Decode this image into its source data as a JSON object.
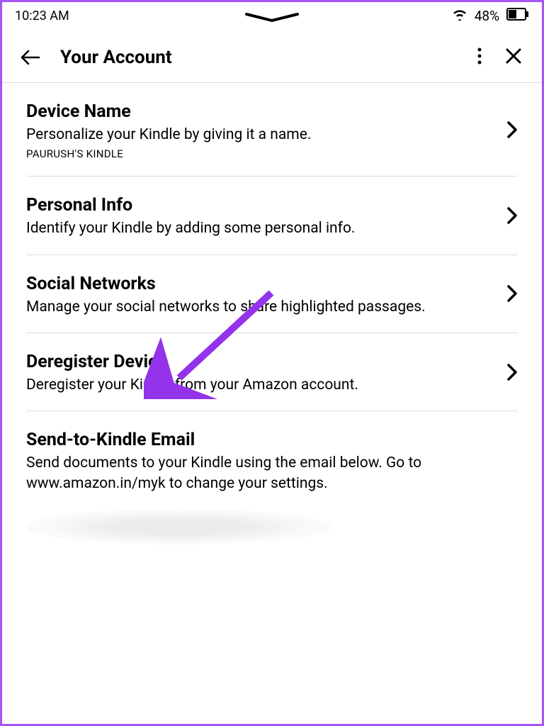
{
  "statusBar": {
    "time": "10:23 AM",
    "batteryPercent": "48%"
  },
  "header": {
    "title": "Your Account"
  },
  "settings": [
    {
      "title": "Device Name",
      "desc": "Personalize your Kindle by giving it a name.",
      "sub": "PAURUSH'S KINDLE",
      "hasChevron": true
    },
    {
      "title": "Personal Info",
      "desc": "Identify your Kindle by adding some personal info.",
      "hasChevron": true
    },
    {
      "title": "Social Networks",
      "desc": "Manage your social networks to share highlighted passages.",
      "hasChevron": true
    },
    {
      "title": "Deregister Device",
      "desc": "Deregister your Kindle from your Amazon account.",
      "hasChevron": true
    },
    {
      "title": "Send-to-Kindle Email",
      "desc": "Send documents to your Kindle using the email below. Go to www.amazon.in/myk to change your settings.",
      "hasChevron": false
    }
  ]
}
